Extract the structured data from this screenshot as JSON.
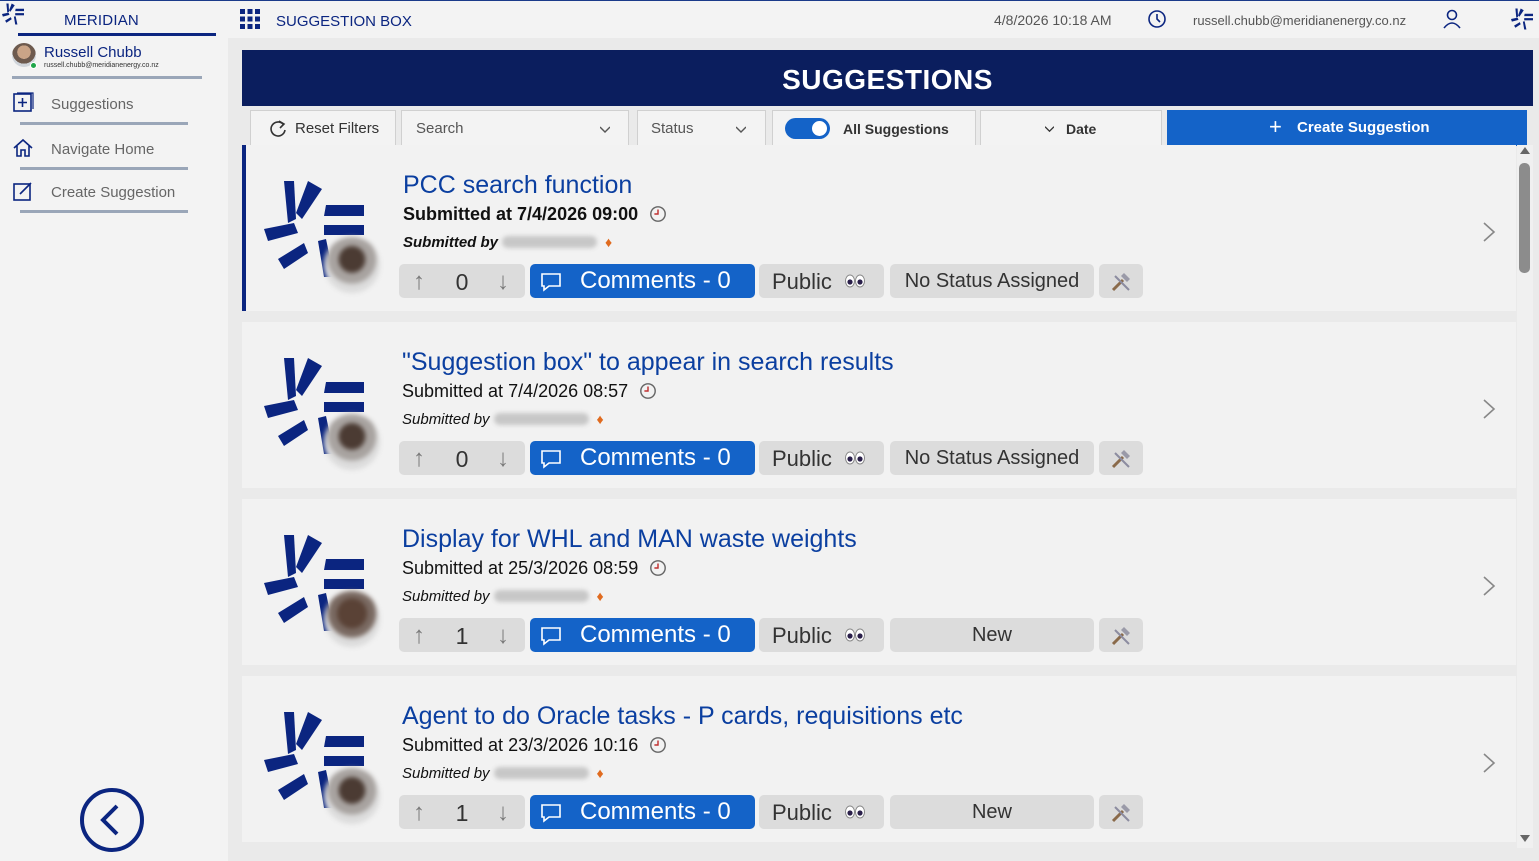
{
  "header": {
    "brand": "MERIDIAN",
    "app_title": "SUGGESTION BOX",
    "datetime": "4/8/2026 10:18 AM",
    "email": "russell.chubb@meridianenergy.co.nz"
  },
  "sidebar": {
    "user_name": "Russell Chubb",
    "user_email": "russell.chubb@meridianenergy.co.nz",
    "items": [
      {
        "label": "Suggestions",
        "icon": "add-box-icon"
      },
      {
        "label": "Navigate Home",
        "icon": "home-icon"
      },
      {
        "label": "Create Suggestion",
        "icon": "edit-icon"
      }
    ]
  },
  "page": {
    "title": "SUGGESTIONS"
  },
  "filters": {
    "reset_label": "Reset Filters",
    "search_placeholder": "Search",
    "status_placeholder": "Status",
    "toggle_label": "All Suggestions",
    "date_label": "Date",
    "create_label": "Create Suggestion"
  },
  "colors": {
    "brand": "#0b2580",
    "header_band": "#0b1e5e",
    "accent": "#1463c8"
  },
  "suggestions": [
    {
      "title": "PCC search function",
      "submitted_prefix": "Submitted at",
      "submitted_at": "7/4/2026 09:00",
      "submitted_by": "Submitted by",
      "votes": "0",
      "comments": "Comments - 0",
      "visibility": "Public",
      "status": "No Status Assigned"
    },
    {
      "title": "\"Suggestion box\" to appear in search results",
      "submitted_prefix": "Submitted at",
      "submitted_at": "7/4/2026 08:57",
      "submitted_by": "Submitted by",
      "votes": "0",
      "comments": "Comments - 0",
      "visibility": "Public",
      "status": "No Status Assigned"
    },
    {
      "title": "Display for WHL and MAN waste weights",
      "submitted_prefix": "Submitted at",
      "submitted_at": "25/3/2026 08:59",
      "submitted_by": "Submitted by",
      "votes": "1",
      "comments": "Comments - 0",
      "visibility": "Public",
      "status": "New"
    },
    {
      "title": "Agent to do Oracle tasks - P cards, requisitions etc",
      "submitted_prefix": "Submitted at",
      "submitted_at": "23/3/2026 10:16",
      "submitted_by": "Submitted by",
      "votes": "1",
      "comments": "Comments - 0",
      "visibility": "Public",
      "status": "New"
    }
  ]
}
